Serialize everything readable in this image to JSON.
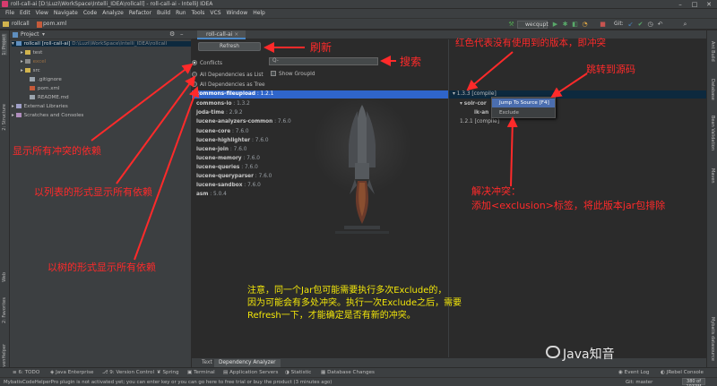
{
  "titlebar": {
    "title": "roll-call-ai [D:\\Luzi\\WorkSpace\\Intelli_IDEA\\rollcall] - roll-call-ai - IntelliJ IDEA"
  },
  "menu": [
    "File",
    "Edit",
    "View",
    "Navigate",
    "Code",
    "Analyze",
    "Refactor",
    "Build",
    "Run",
    "Tools",
    "VCS",
    "Window",
    "Help"
  ],
  "navbar": {
    "crumb1": "rollcall",
    "crumb2": "pom.xml",
    "run_config": "wecqupt",
    "git_label": "Git:"
  },
  "left_stripe": {
    "project": "1: Project",
    "structure": "2: Structure",
    "web": "Web",
    "favorites": "2: Favorites",
    "maven_helper": "MavenHelper"
  },
  "right_stripe": {
    "ant": "Ant Build",
    "database": "Database",
    "bean_validation": "Bean Validation",
    "maven": "Maven",
    "mybatis": "Mybatis datasource"
  },
  "project_panel": {
    "title": "Project",
    "items": [
      {
        "label": "rollcall [roll-call-ai]",
        "path": "D:\\Luzi\\WorkSpace\\Intelli_IDEA\\rollcall"
      },
      {
        "label": "test"
      },
      {
        "label": "excel"
      },
      {
        "label": "src"
      },
      {
        "label": ".gitignore"
      },
      {
        "label": "pom.xml"
      },
      {
        "label": "README.md"
      },
      {
        "label": "External Libraries"
      },
      {
        "label": "Scratches and Consoles"
      }
    ]
  },
  "analyzer": {
    "tab": "roll-call-ai",
    "refresh": "Refresh",
    "radios": [
      "Conflicts",
      "All Dependencies as List",
      "All Dependencies as Tree"
    ],
    "search_placeholder": "Q-",
    "show_groupid": "Show GroupId",
    "dependencies": [
      {
        "name": "commons-fileupload",
        "version": " : 1.2.1"
      },
      {
        "name": "commons-io",
        "version": " : 1.3.2"
      },
      {
        "name": "joda-time",
        "version": " : 2.9.2"
      },
      {
        "name": "lucene-analyzers-common",
        "version": " : 7.6.0"
      },
      {
        "name": "lucene-core",
        "version": " : 7.6.0"
      },
      {
        "name": "lucene-highlighter",
        "version": " : 7.6.0"
      },
      {
        "name": "lucene-join",
        "version": " : 7.6.0"
      },
      {
        "name": "lucene-memory",
        "version": " : 7.6.0"
      },
      {
        "name": "lucene-queries",
        "version": " : 7.6.0"
      },
      {
        "name": "lucene-queryparser",
        "version": " : 7.6.0"
      },
      {
        "name": "lucene-sandbox",
        "version": " : 7.6.0"
      },
      {
        "name": "asm",
        "version": " : 5.0.4"
      }
    ],
    "tree": {
      "row1": "1.3.3 [compile]",
      "row2": "solr-cor",
      "row3": "ik-an",
      "row4": "1.2.1 [compile]"
    },
    "context_menu": [
      "Jump To Source [F4]",
      "Exclude"
    ],
    "bottom_tabs": [
      "Text",
      "Dependency Analyzer"
    ]
  },
  "toolwindows": [
    "6: TODO",
    "Java Enterprise",
    "9: Version Control",
    "Spring",
    "Terminal",
    "Application Servers",
    "Statistic",
    "Database Changes",
    "Event Log",
    "JRebel Console"
  ],
  "status": {
    "message": "MybatisCodeHelperPro plugin is not activated yet; you can enter key or you can go here to free trial or buy the product (3 minutes ago)",
    "git": "Git: master",
    "memory": "380 of 1933M"
  },
  "annotations": {
    "refresh": "刷新",
    "search": "搜索",
    "red_meaning": "红色代表没有使用到的版本，即冲突",
    "jump": "跳转到源码",
    "conflicts": "显示所有冲突的依赖",
    "as_list": "以列表的形式显示所有依赖",
    "as_tree": "以树的形式显示所有依赖",
    "resolve_1": "解决冲突：",
    "resolve_2": "添加<exclusion>标签，将此版本jar包排除",
    "note_1": "注意，同一个Jar包可能需要执行多次Exclude的，",
    "note_2": "因为可能会有多处冲突。执行一次Exclude之后，需要",
    "note_3": "Refresh一下，才能确定是否有新的冲突。",
    "watermark": "Java知音"
  },
  "colors": {
    "annotation_red": "#ff2a2a",
    "annotation_yellow": "#f2e60a",
    "selection_blue": "#2f65ca",
    "conflict_red": "#ff5b5b"
  }
}
